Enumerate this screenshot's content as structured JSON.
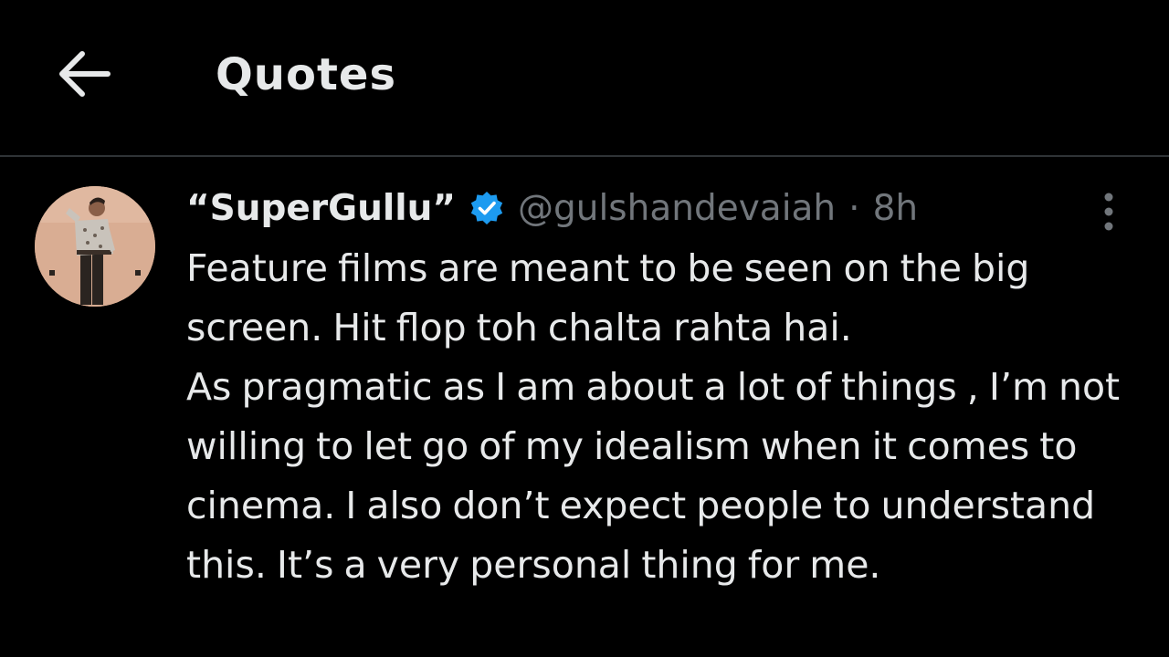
{
  "header": {
    "back_icon": "arrow-left-icon",
    "title": "Quotes"
  },
  "tweet": {
    "avatar_icon": "user-avatar",
    "display_name": "“SuperGullu”",
    "verified_icon": "verified-badge-icon",
    "verified_color": "#1d9bf0",
    "handle": "@gulshandevaiah",
    "separator": "·",
    "time": "8h",
    "more_icon": "more-vertical-icon",
    "text_para1": "Feature films are meant to be seen on the big screen. Hit flop toh chalta rahta hai.",
    "text_para2": "As pragmatic as I am about a lot of things , I’m not willing to let go of my idealism when it comes to cinema. I also don’t expect people to understand this. It’s a very personal thing for me."
  },
  "colors": {
    "background": "#000000",
    "text_primary": "#e7e9ea",
    "text_secondary": "#71767b",
    "divider": "#2f3336",
    "accent": "#1d9bf0"
  }
}
